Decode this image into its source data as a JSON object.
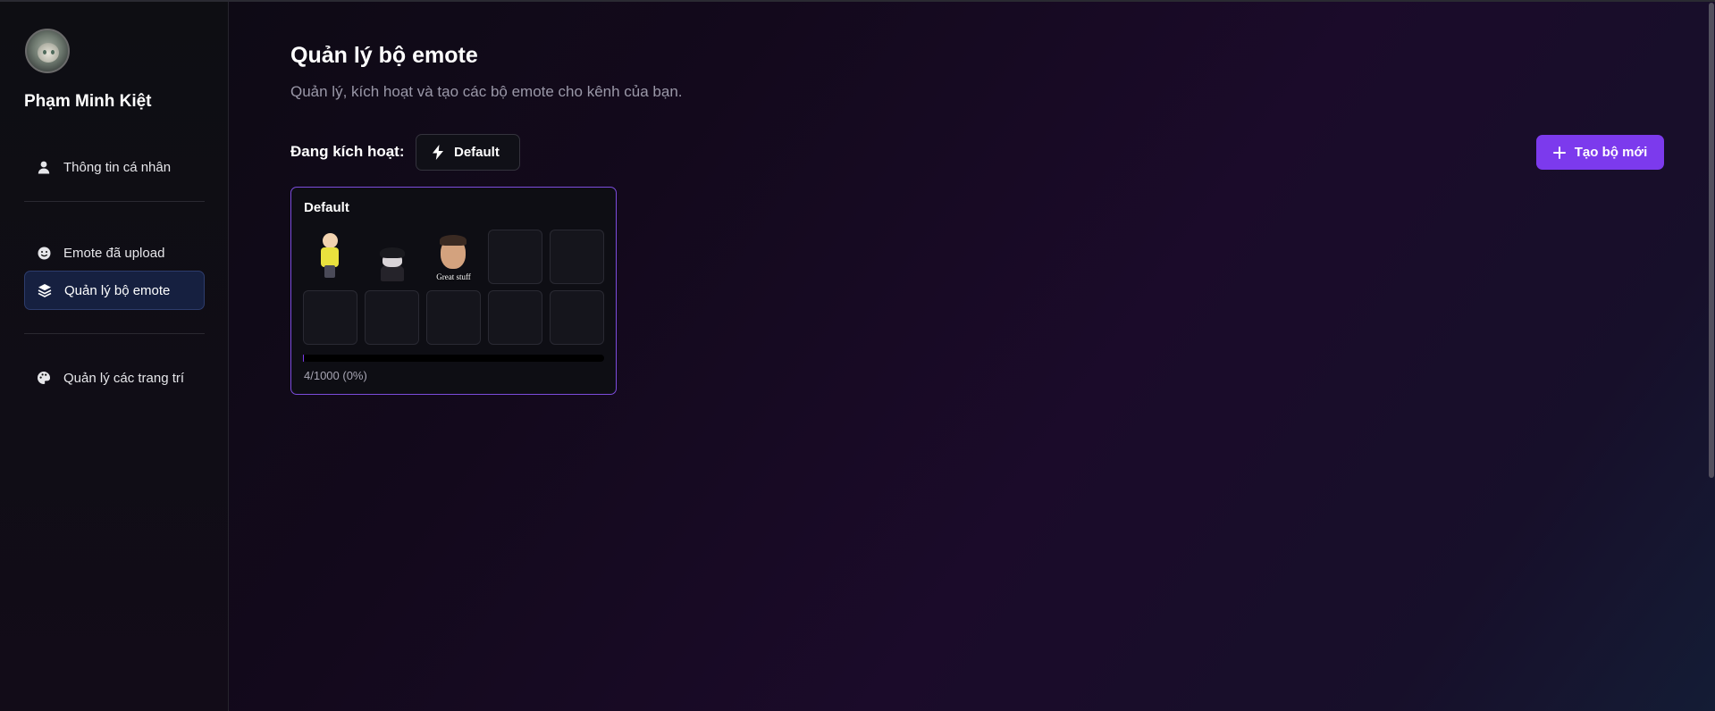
{
  "user": {
    "name": "Phạm Minh Kiệt"
  },
  "sidebar": {
    "items": [
      {
        "label": "Thông tin cá nhân",
        "icon": "user-icon",
        "active": false
      },
      {
        "label": "Emote đã upload",
        "icon": "smile-icon",
        "active": false
      },
      {
        "label": "Quản lý bộ emote",
        "icon": "layers-icon",
        "active": true
      },
      {
        "label": "Quản lý các trang trí",
        "icon": "palette-icon",
        "active": false
      }
    ]
  },
  "main": {
    "title": "Quản lý bộ emote",
    "subtitle": "Quản lý, kích hoạt và tạo các bộ emote cho kênh của bạn.",
    "active_label": "Đang kích hoạt:",
    "active_set": "Default",
    "create_button": "Tạo bộ mới"
  },
  "sets": [
    {
      "name": "Default",
      "emote_count": 4,
      "emote_limit": 1000,
      "progress_fraction": 0.004,
      "progress_text": "4/1000 (0%)",
      "preview_emotes": [
        {
          "kind": "cartoon-character"
        },
        {
          "kind": "hooded-figure"
        },
        {
          "kind": "photo",
          "caption": "Great stuff"
        }
      ],
      "empty_slots": 7
    }
  ],
  "colors": {
    "accent": "#7c3aed",
    "active_nav_bg": "#162040",
    "card_border": "#7c4cdc"
  }
}
